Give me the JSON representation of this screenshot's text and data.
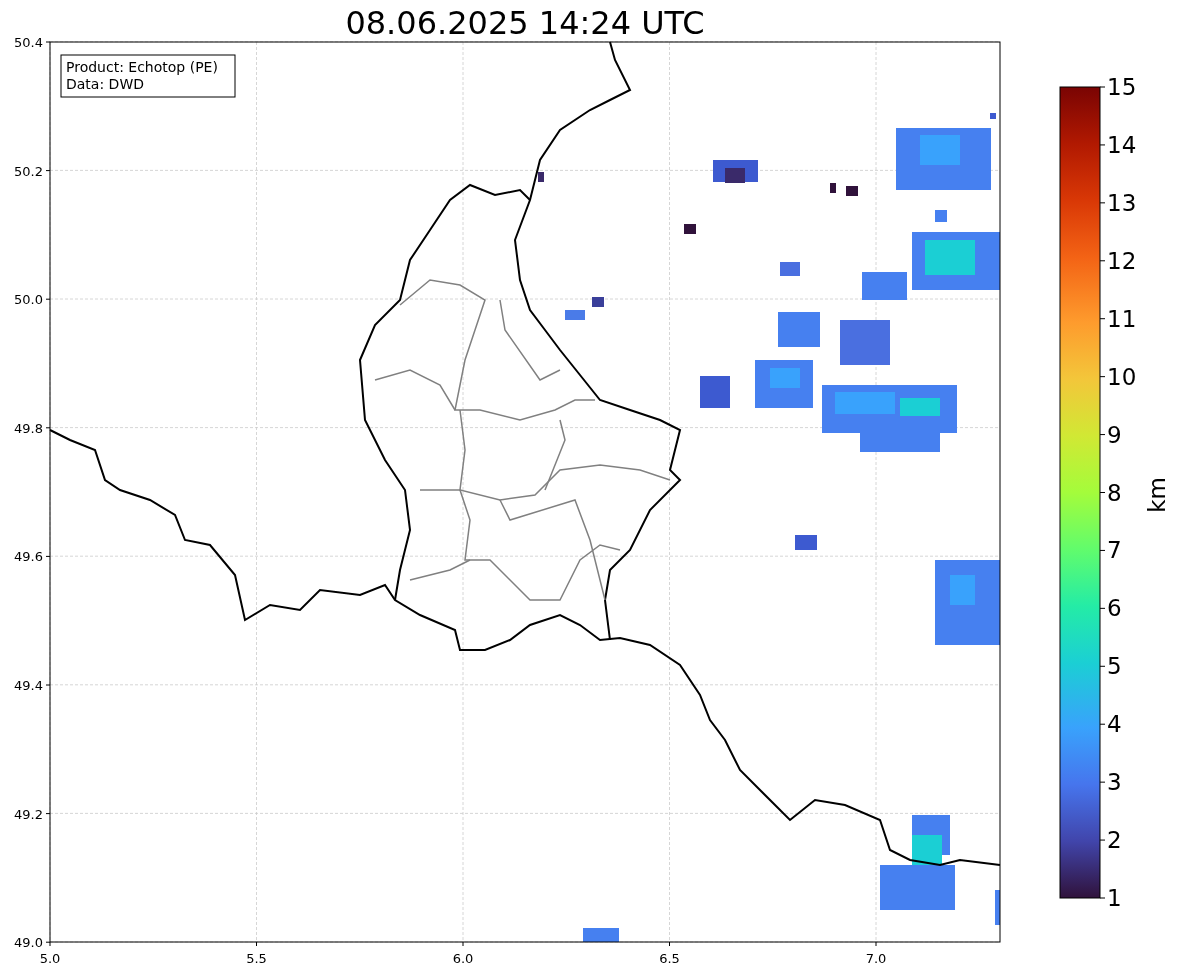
{
  "title": "08.06.2025 14:24 UTC",
  "info_box": [
    "Product: Echotop (PE)",
    "Data: DWD"
  ],
  "x_ticks": [
    "5.0",
    "5.5",
    "6.0",
    "6.5",
    "7.0"
  ],
  "y_ticks": [
    "50.4",
    "50.2",
    "50.0",
    "49.8",
    "49.6",
    "49.4",
    "49.2",
    "49.0"
  ],
  "colorbar": {
    "label": "km",
    "ticks": [
      "15",
      "14",
      "13",
      "12",
      "11",
      "10",
      "9",
      "8",
      "7",
      "6",
      "5",
      "4",
      "3",
      "2",
      "1"
    ]
  }
}
